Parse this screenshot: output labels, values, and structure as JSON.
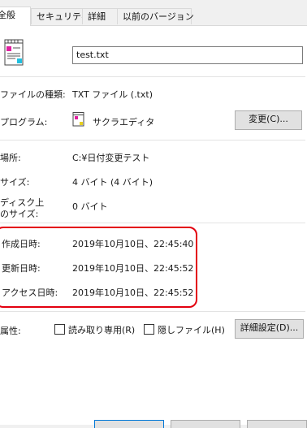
{
  "tabs": [
    "全般",
    "セキュリティ",
    "詳細",
    "以前のバージョン"
  ],
  "file": {
    "name": "test.txt",
    "icon": "text-file-icon"
  },
  "rows": {
    "type_label": "ファイルの種類:",
    "type_value": "TXT ファイル (.txt)",
    "program_label": "プログラム:",
    "program_value": "サクラエディタ",
    "program_icon": "sakura-editor-icon",
    "change_button": "変更(C)...",
    "location_label": "場所:",
    "location_value": "C:¥日付変更テスト",
    "size_label": "サイズ:",
    "size_value": "4 バイト (4 バイト)",
    "disk_size_label_line1": "ディスク上",
    "disk_size_label_line2": "のサイズ:",
    "disk_size_value": "0 バイト",
    "created_label": "作成日時:",
    "created_value": "2019年10月10日、22:45:40",
    "modified_label": "更新日時:",
    "modified_value": "2019年10月10日、22:45:52",
    "accessed_label": "アクセス日時:",
    "accessed_value": "2019年10月10日、22:45:52",
    "attributes_label": "属性:",
    "readonly_label": "読み取り専用(R)",
    "hidden_label": "隠しファイル(H)",
    "advanced_button": "詳細設定(D)..."
  },
  "colors": {
    "highlight": "#e3000f",
    "accent": "#0078d7"
  }
}
